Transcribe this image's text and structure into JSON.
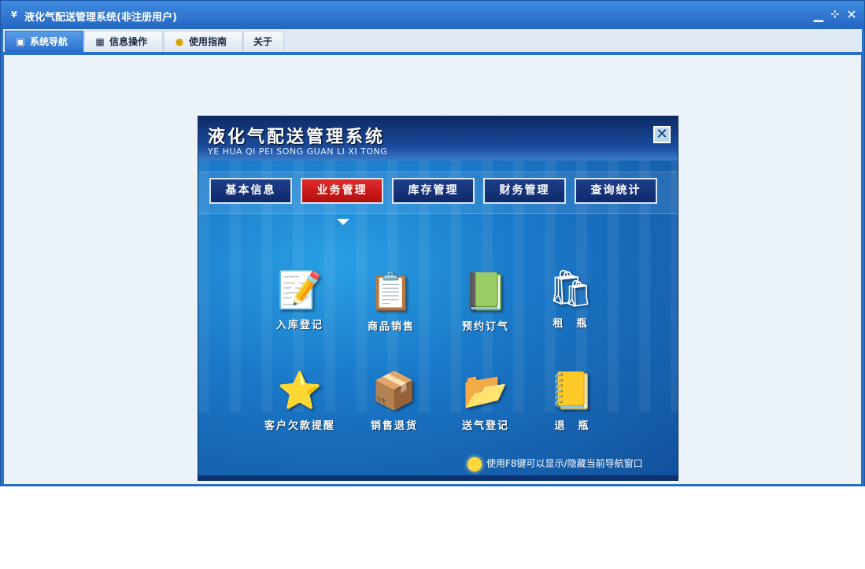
{
  "window": {
    "title": "液化气配送管理系统(非注册用户)",
    "app_icon": "yf-logo-icon",
    "controls": {
      "minimize": "minimize-icon",
      "restore": "restore-icon",
      "close": "close-icon"
    }
  },
  "tabs": [
    {
      "label": "系统导航",
      "icon": "monitor-icon",
      "active": true
    },
    {
      "label": "信息操作",
      "icon": "grid-icon",
      "active": false
    },
    {
      "label": "使用指南",
      "icon": "help-coin-icon",
      "active": false
    },
    {
      "label": "关于",
      "icon": "",
      "active": false
    }
  ],
  "nav_panel": {
    "title": "液化气配送管理系统",
    "subtitle": "YE HUA QI PEI SONG GUAN LI XI TONG",
    "categories": [
      {
        "label": "基本信息",
        "active": false
      },
      {
        "label": "业务管理",
        "active": true
      },
      {
        "label": "库存管理",
        "active": false
      },
      {
        "label": "财务管理",
        "active": false
      },
      {
        "label": "查询统计",
        "active": false
      }
    ],
    "functions": [
      {
        "label": "入库登记",
        "icon": "notepad-user-icon"
      },
      {
        "label": "商品销售",
        "icon": "clipboard-pen-icon"
      },
      {
        "label": "预约订气",
        "icon": "book-user-icon"
      },
      {
        "label": "租　瓶",
        "icon": "user-bag-icon"
      },
      {
        "label": "客户欠款提醒",
        "icon": "star-folder-icon"
      },
      {
        "label": "销售退货",
        "icon": "crate-icon"
      },
      {
        "label": "送气登记",
        "icon": "folder-pen-icon"
      },
      {
        "label": "退　瓶",
        "icon": "binder-icon"
      }
    ],
    "tip": "使用F8键可以显示/隐藏当前导航窗口"
  },
  "colors": {
    "accent": "#2a6fcc",
    "active_category": "#c8141a",
    "panel_blue": "#1a78c8"
  }
}
